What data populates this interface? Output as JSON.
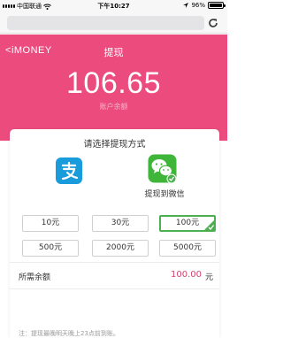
{
  "status_bar": {
    "carrier": "中国联通",
    "time": "下午10:27",
    "battery": "96%"
  },
  "header": {
    "brand": "iMONEY",
    "back_symbol": "<",
    "title": "提现",
    "balance": "106.65",
    "balance_label": "账户余额",
    "color": "#eb4b7d"
  },
  "withdraw": {
    "method_title": "请选择提现方式",
    "methods": [
      {
        "name": "alipay",
        "icon": "alipay-icon",
        "label": ""
      },
      {
        "name": "wechat",
        "icon": "wechat-icon",
        "label": "提现到微信",
        "selected": true
      }
    ],
    "amount_options": [
      "10元",
      "30元",
      "100元",
      "500元",
      "2000元",
      "5000元"
    ],
    "selected_amount": "100元",
    "required_label": "所需余额",
    "required_value": "100.00",
    "required_unit": "元",
    "note": "注：提现最晚明天晚上23点前到账。"
  },
  "colors": {
    "selected_border": "#4cb050",
    "accent_text": "#d1446e",
    "alipay_blue": "#1a9bdc",
    "wechat_green": "#3fb53a"
  }
}
